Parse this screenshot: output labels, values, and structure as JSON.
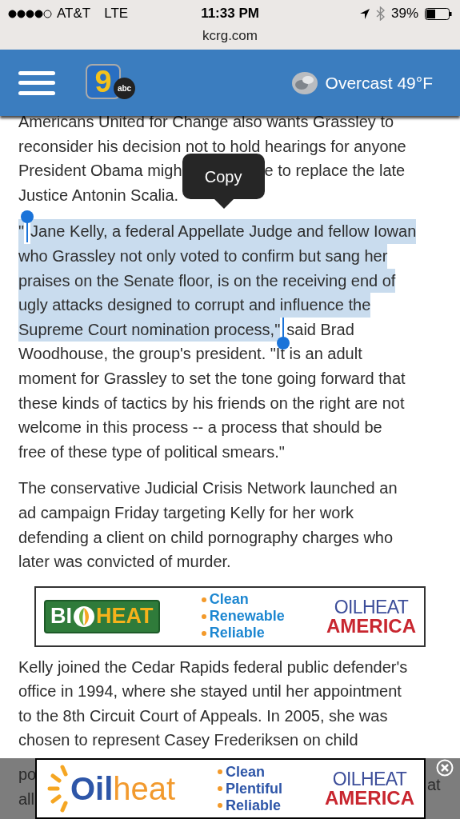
{
  "status_bar": {
    "carrier": "AT&T",
    "network": "LTE",
    "signal_dots": [
      {
        "filled": true
      },
      {
        "filled": true
      },
      {
        "filled": true
      },
      {
        "filled": true
      },
      {
        "filled": false
      }
    ],
    "time": "11:33 PM",
    "battery": "39%",
    "url": "kcrg.com"
  },
  "header": {
    "logo": {
      "numeral": "9",
      "network": "abc"
    },
    "weather": "Overcast 49°F"
  },
  "paragraphs": [
    {
      "lines": [
        {
          "segments": [
            {
              "kind": "text",
              "text": "Americans United for Change also wants Grassley to",
              "selected": false
            }
          ]
        },
        {
          "segments": [
            {
              "kind": "text",
              "text": "reconsider his decision not to hold hearings for anyone",
              "selected": false
            }
          ]
        },
        {
          "segments": [
            {
              "kind": "text",
              "text": "President Obama migh",
              "selected": false
            },
            {
              "kind": "popup",
              "text": "Copy"
            },
            {
              "kind": "text",
              "text": "e to replace the late",
              "selected": false
            }
          ]
        },
        {
          "segments": [
            {
              "kind": "text",
              "text": "Justice Antonin Scalia.",
              "selected": false
            }
          ]
        }
      ]
    },
    {
      "lines": [
        {
          "segments": [
            {
              "kind": "text",
              "text": "\"",
              "selected": true
            },
            {
              "kind": "handle_start"
            },
            {
              "kind": "text",
              "text": "Jane Kelly, a federal Appellate Judge and fellow Iowan",
              "selected": true
            }
          ]
        },
        {
          "segments": [
            {
              "kind": "text",
              "text": "who Grassley not only voted to confirm but sang her",
              "selected": true
            }
          ]
        },
        {
          "segments": [
            {
              "kind": "text",
              "text": "praises on the Senate floor, is on the receiving end of",
              "selected": true
            }
          ]
        },
        {
          "segments": [
            {
              "kind": "text",
              "text": "ugly attacks designed to corrupt and influence the",
              "selected": true
            }
          ]
        },
        {
          "segments": [
            {
              "kind": "text",
              "text": "Supreme Court nomination process,\"",
              "selected": true
            },
            {
              "kind": "handle_end"
            },
            {
              "kind": "text",
              "text": "said Brad",
              "selected": false
            }
          ]
        },
        {
          "segments": [
            {
              "kind": "text",
              "text": "Woodhouse, the group's president. \"It is an adult",
              "selected": false
            }
          ]
        },
        {
          "segments": [
            {
              "kind": "text",
              "text": "moment for Grassley to set the tone going forward that",
              "selected": false
            }
          ]
        },
        {
          "segments": [
            {
              "kind": "text",
              "text": "these kinds of tactics by his friends on the right are not",
              "selected": false
            }
          ]
        },
        {
          "segments": [
            {
              "kind": "text",
              "text": "welcome in this process -- a process that should be",
              "selected": false
            }
          ]
        },
        {
          "segments": [
            {
              "kind": "text",
              "text": "free of these type of political smears.\"",
              "selected": false
            }
          ]
        }
      ]
    },
    {
      "lines": [
        {
          "segments": [
            {
              "kind": "text",
              "text": "The conservative Judicial Crisis Network launched an",
              "selected": false
            }
          ]
        },
        {
          "segments": [
            {
              "kind": "text",
              "text": "ad campaign Friday targeting Kelly for her work",
              "selected": false
            }
          ]
        },
        {
          "segments": [
            {
              "kind": "text",
              "text": "defending a client on child pornography charges who",
              "selected": false
            }
          ]
        },
        {
          "segments": [
            {
              "kind": "text",
              "text": "later was convicted of murder.",
              "selected": false
            }
          ]
        }
      ]
    },
    {
      "kind": "ad",
      "brand_left": "BI",
      "brand_right": "HEAT",
      "bullets": [
        "Clean",
        "Renewable",
        "Reliable"
      ],
      "partner_top": "OILHEAT",
      "partner_bottom": "AMERICA"
    },
    {
      "lines": [
        {
          "segments": [
            {
              "kind": "text",
              "text": "Kelly joined the Cedar Rapids federal public defender's",
              "selected": false
            }
          ]
        },
        {
          "segments": [
            {
              "kind": "text",
              "text": "office in 1994, where she stayed until her appointment",
              "selected": false
            }
          ]
        },
        {
          "segments": [
            {
              "kind": "text",
              "text": "to the 8th Circuit Court of Appeals. In 2005, she was",
              "selected": false
            }
          ]
        },
        {
          "segments": [
            {
              "kind": "text",
              "text": "chosen to represent Casey Frederiksen on child",
              "selected": false
            }
          ]
        }
      ]
    }
  ],
  "sticky_ad": {
    "covered_text_left": [
      "po",
      "all"
    ],
    "covered_text_right": [
      "at"
    ],
    "brand_left": "Oil",
    "brand_right": "heat",
    "bullets": [
      "Clean",
      "Plentiful",
      "Reliable"
    ],
    "partner_top": "OILHEAT",
    "partner_bottom": "AMERICA"
  }
}
